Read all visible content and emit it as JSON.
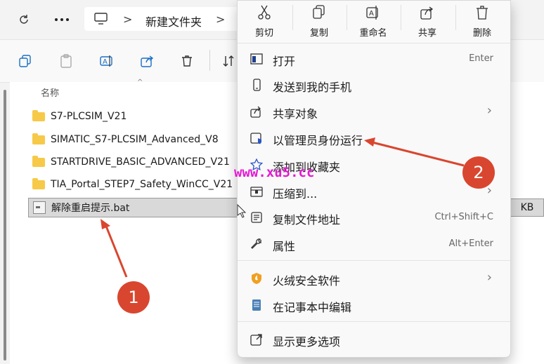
{
  "address": {
    "folder_name": "新建文件夹",
    "separator": ">"
  },
  "file_list": {
    "column_header": "名称",
    "folders": [
      "S7-PLCSIM_V21",
      "SIMATIC_S7-PLCSIM_Advanced_V8",
      "STARTDRIVE_BASIC_ADVANCED_V21",
      "TIA_Portal_STEP7_Safety_WinCC_V21"
    ],
    "selected_file": "解除重启提示.bat",
    "size_cell": "KB"
  },
  "context_menu": {
    "quick_actions": [
      "剪切",
      "复制",
      "重命名",
      "共享",
      "删除"
    ],
    "items": [
      {
        "label": "打开",
        "shortcut": "Enter"
      },
      {
        "label": "发送到我的手机"
      },
      {
        "label": "共享对象",
        "chevron": "›"
      },
      {
        "label": "以管理员身份运行"
      },
      {
        "label": "添加到收藏夹"
      },
      {
        "label": "压缩到...",
        "chevron": "›"
      },
      {
        "label": "复制文件地址",
        "shortcut": "Ctrl+Shift+C"
      },
      {
        "label": "属性",
        "shortcut": "Alt+Enter"
      },
      {
        "label": "火绒安全软件",
        "chevron": "›"
      },
      {
        "label": "在记事本中编辑"
      },
      {
        "label": "显示更多选项"
      }
    ]
  },
  "annotations": {
    "badge1": "1",
    "badge2": "2",
    "watermark": "www.xu5.cc",
    "color": "#d9462f"
  }
}
